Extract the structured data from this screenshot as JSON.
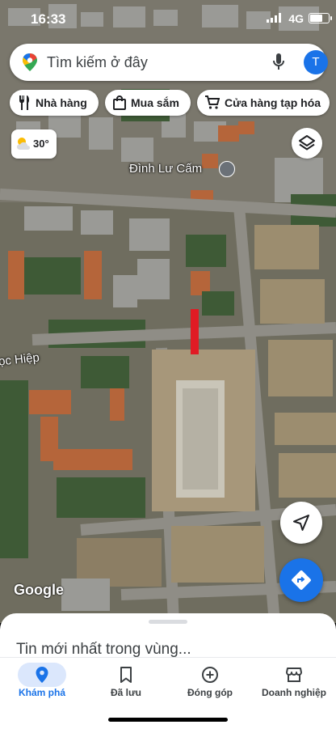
{
  "status_bar": {
    "time": "16:33",
    "network": "4G",
    "battery_level": 0.75
  },
  "search": {
    "placeholder": "Tìm kiếm ở đây",
    "avatar_letter": "T"
  },
  "chips": [
    {
      "label": "Nhà hàng",
      "icon": "restaurant-icon"
    },
    {
      "label": "Mua sắm",
      "icon": "shopping-bag-icon"
    },
    {
      "label": "Cửa hàng tạp hóa",
      "icon": "cart-icon"
    }
  ],
  "weather": {
    "temp": "30°",
    "icon": "partly-cloudy-icon"
  },
  "map": {
    "place_label": "Đình Lư Cấm",
    "street_label": "ọc Hiệp",
    "attribution": "Google"
  },
  "sheet": {
    "latest": "Tin mới nhất trong vùng..."
  },
  "nav": {
    "tabs": [
      {
        "label": "Khám phá",
        "icon": "explore-pin-icon",
        "active": true
      },
      {
        "label": "Đã lưu",
        "icon": "bookmark-icon",
        "active": false
      },
      {
        "label": "Đóng góp",
        "icon": "add-circle-icon",
        "active": false
      },
      {
        "label": "Doanh nghiệp",
        "icon": "storefront-icon",
        "active": false
      }
    ]
  },
  "colors": {
    "accent": "#1a73e8",
    "marker": "#e01b24",
    "active_tab_bg": "#dbe7fc"
  }
}
